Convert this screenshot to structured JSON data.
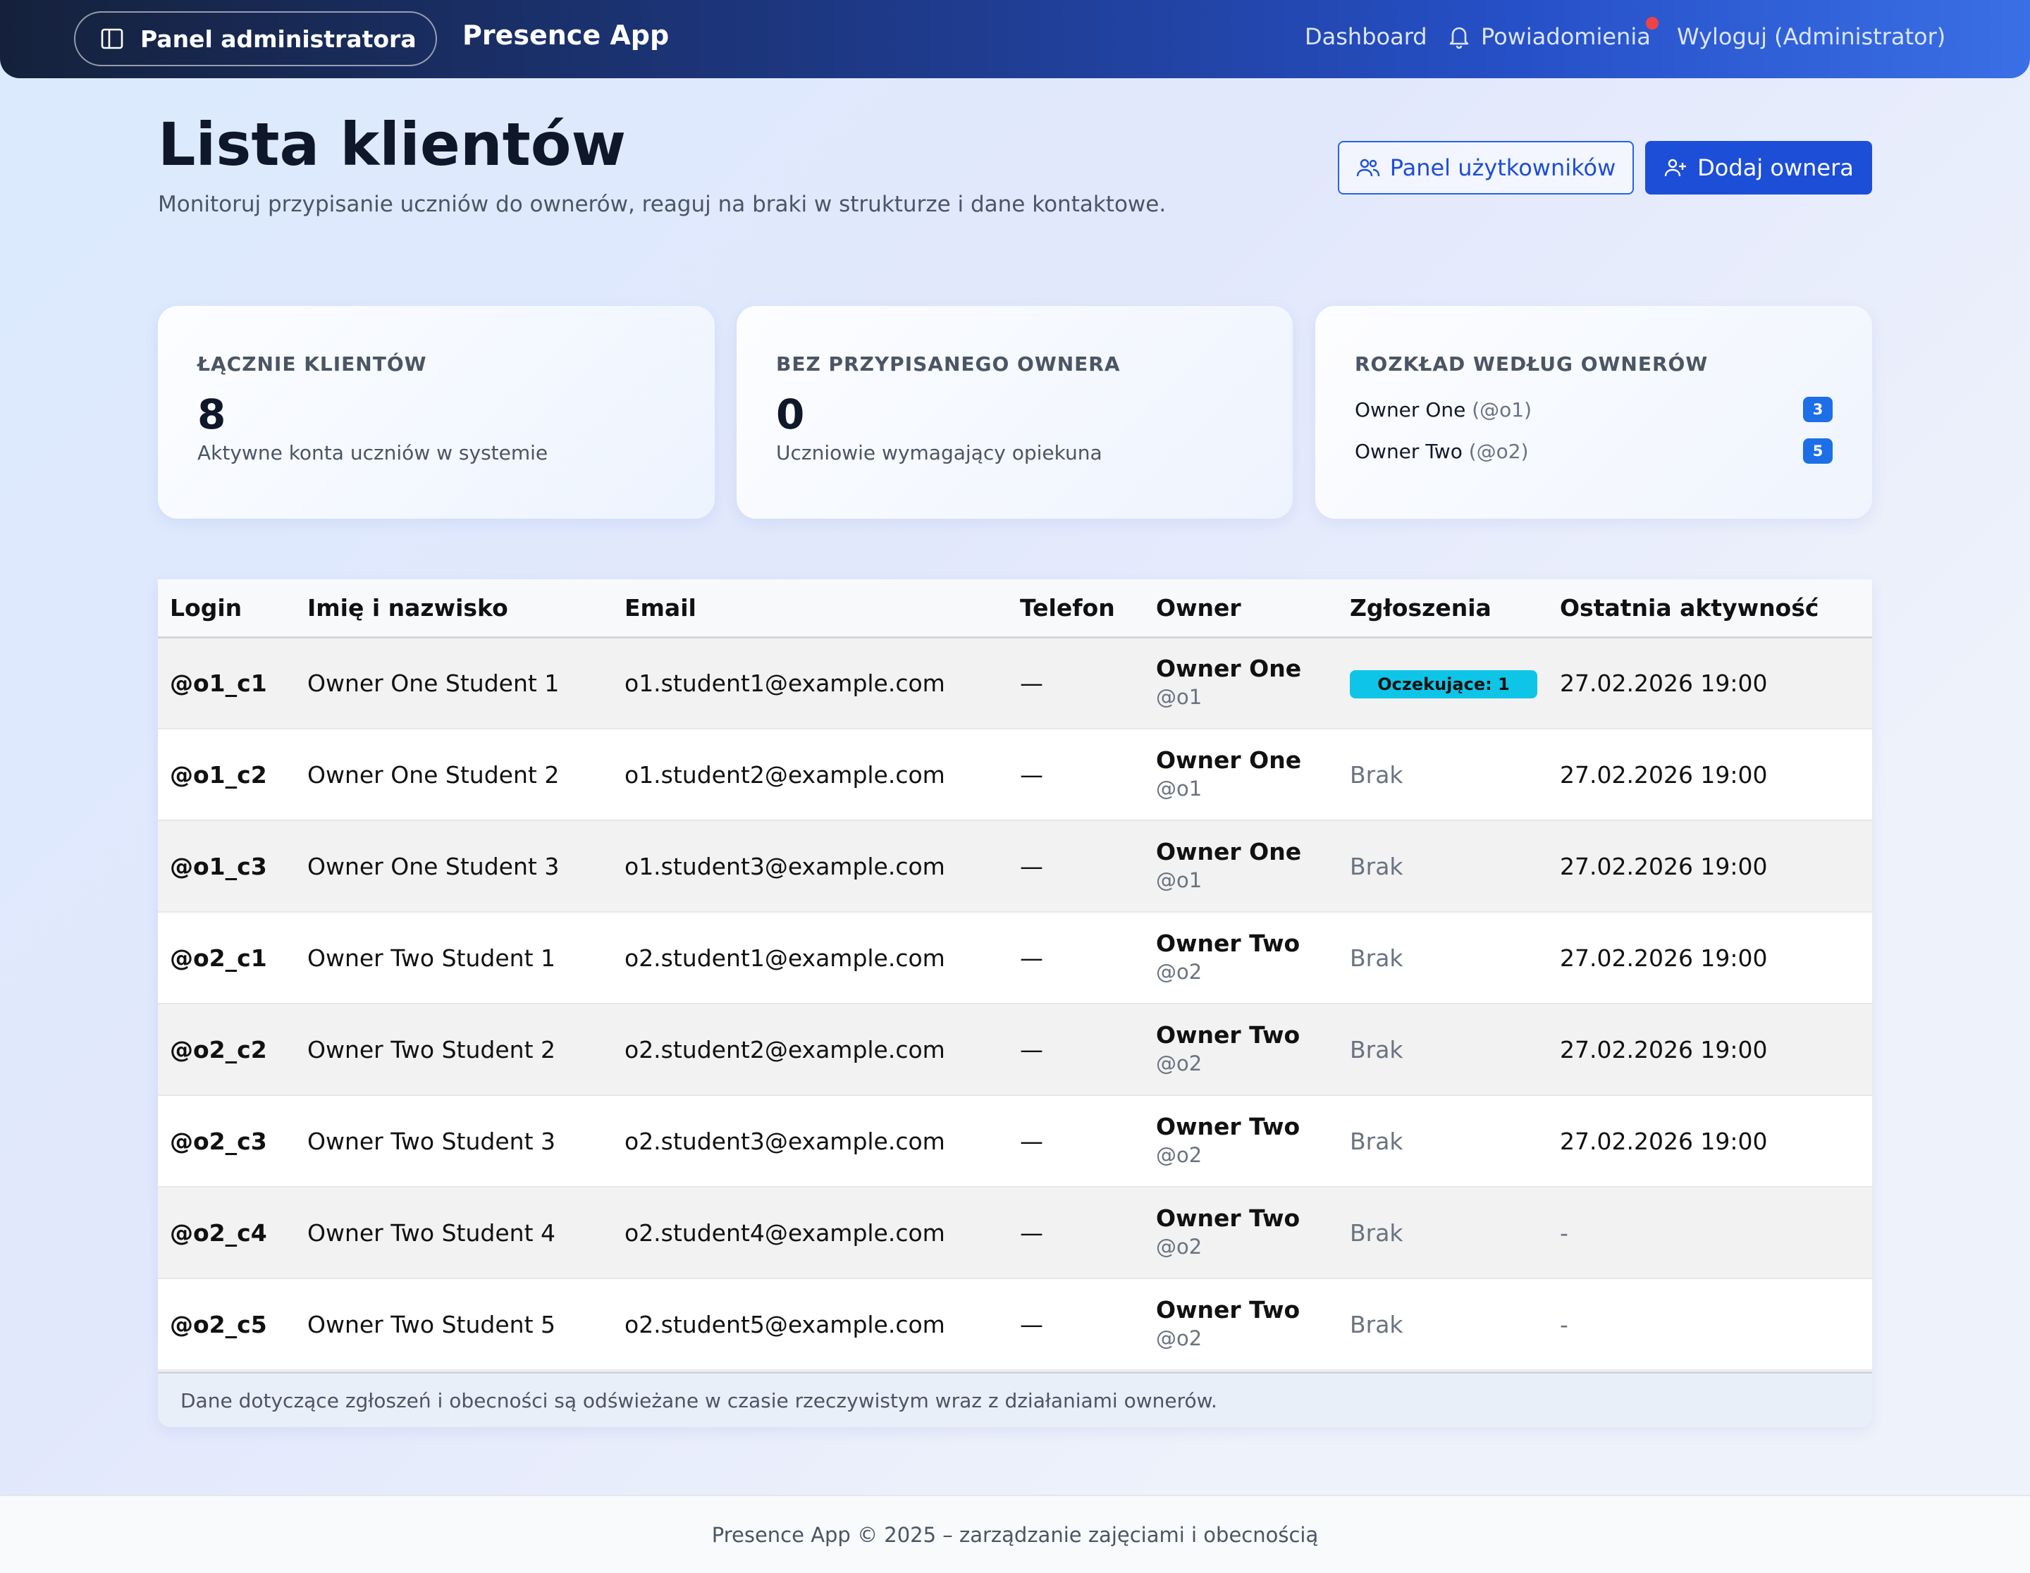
{
  "navbar": {
    "panel_label": "Panel administratora",
    "brand": "Presence App",
    "dashboard": "Dashboard",
    "notifications": "Powiadomienia",
    "logout": "Wyloguj (Administrator)"
  },
  "header": {
    "title": "Lista klientów",
    "subtitle": "Monitoruj przypisanie uczniów do ownerów, reaguj na braki w strukturze i dane kontaktowe.",
    "users_button": "Panel użytkowników",
    "add_button": "Dodaj ownera"
  },
  "cards": {
    "total": {
      "label": "ŁĄCZNIE KLIENTÓW",
      "value": "8",
      "desc": "Aktywne konta uczniów w systemie"
    },
    "unassigned": {
      "label": "BEZ PRZYPISANEGO OWNERA",
      "value": "0",
      "desc": "Uczniowie wymagający opiekuna"
    },
    "distribution": {
      "label": "ROZKŁAD WEDŁUG OWNERÓW",
      "owners": [
        {
          "name": "Owner One",
          "handle": "(@o1)",
          "count": "3"
        },
        {
          "name": "Owner Two",
          "handle": "(@o2)",
          "count": "5"
        }
      ]
    }
  },
  "table": {
    "headers": [
      "Login",
      "Imię i nazwisko",
      "Email",
      "Telefon",
      "Owner",
      "Zgłoszenia",
      "Ostatnia aktywność"
    ],
    "rows": [
      {
        "login": "@o1_c1",
        "name": "Owner One Student 1",
        "email": "o1.student1@example.com",
        "phone": "—",
        "owner": "Owner One",
        "owner_handle": "@o1",
        "reports": "Oczekujące: 1",
        "reports_badge": true,
        "activity": "27.02.2026 19:00"
      },
      {
        "login": "@o1_c2",
        "name": "Owner One Student 2",
        "email": "o1.student2@example.com",
        "phone": "—",
        "owner": "Owner One",
        "owner_handle": "@o1",
        "reports": "Brak",
        "reports_badge": false,
        "activity": "27.02.2026 19:00"
      },
      {
        "login": "@o1_c3",
        "name": "Owner One Student 3",
        "email": "o1.student3@example.com",
        "phone": "—",
        "owner": "Owner One",
        "owner_handle": "@o1",
        "reports": "Brak",
        "reports_badge": false,
        "activity": "27.02.2026 19:00"
      },
      {
        "login": "@o2_c1",
        "name": "Owner Two Student 1",
        "email": "o2.student1@example.com",
        "phone": "—",
        "owner": "Owner Two",
        "owner_handle": "@o2",
        "reports": "Brak",
        "reports_badge": false,
        "activity": "27.02.2026 19:00"
      },
      {
        "login": "@o2_c2",
        "name": "Owner Two Student 2",
        "email": "o2.student2@example.com",
        "phone": "—",
        "owner": "Owner Two",
        "owner_handle": "@o2",
        "reports": "Brak",
        "reports_badge": false,
        "activity": "27.02.2026 19:00"
      },
      {
        "login": "@o2_c3",
        "name": "Owner Two Student 3",
        "email": "o2.student3@example.com",
        "phone": "—",
        "owner": "Owner Two",
        "owner_handle": "@o2",
        "reports": "Brak",
        "reports_badge": false,
        "activity": "27.02.2026 19:00"
      },
      {
        "login": "@o2_c4",
        "name": "Owner Two Student 4",
        "email": "o2.student4@example.com",
        "phone": "—",
        "owner": "Owner Two",
        "owner_handle": "@o2",
        "reports": "Brak",
        "reports_badge": false,
        "activity": "-"
      },
      {
        "login": "@o2_c5",
        "name": "Owner Two Student 5",
        "email": "o2.student5@example.com",
        "phone": "—",
        "owner": "Owner Two",
        "owner_handle": "@o2",
        "reports": "Brak",
        "reports_badge": false,
        "activity": "-"
      }
    ],
    "footer_note": "Dane dotyczące zgłoszeń i obecności są odświeżane w czasie rzeczywistym wraz z działaniami ownerów."
  },
  "footer": {
    "text": "Presence App © 2025 – zarządzanie zajęciami i obecnością"
  },
  "colors": {
    "primary": "#1d4ed8",
    "badge_waiting": "#0ec5e8",
    "notification_dot": "#ef4444",
    "count_pill": "#1d6fe8"
  },
  "icons": {
    "panel": "sidebar-icon",
    "notifications": "bell-icon",
    "users": "users-icon",
    "add_owner": "user-plus-icon"
  }
}
